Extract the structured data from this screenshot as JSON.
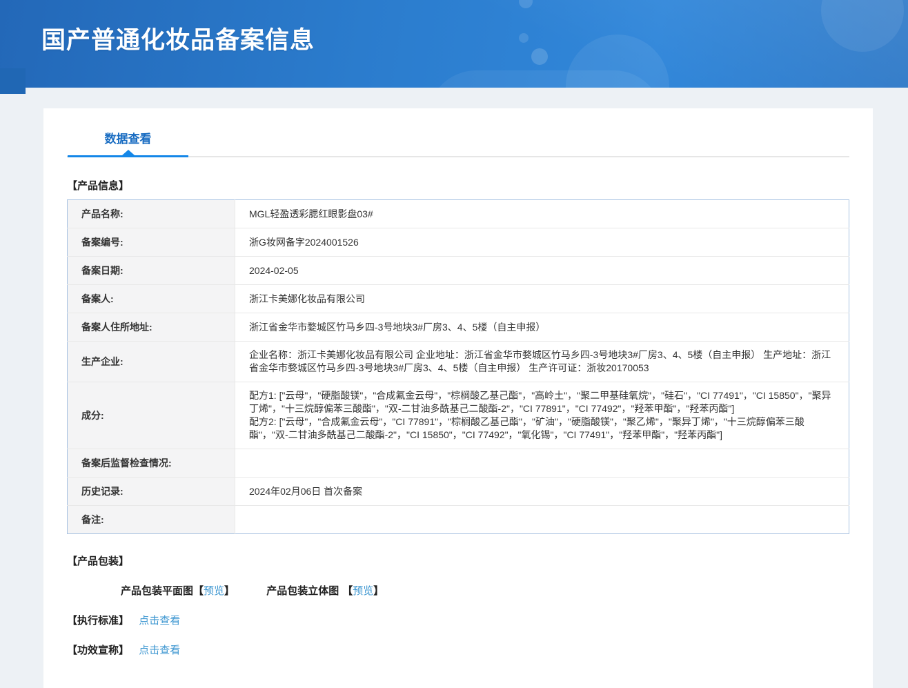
{
  "header": {
    "title": "国产普通化妆品备案信息"
  },
  "tabs": {
    "data_view": "数据查看"
  },
  "sections": {
    "product_info": "【产品信息】",
    "product_packaging": "【产品包装】",
    "execution_standard": "【执行标准】",
    "efficacy_claim": "【功效宣称】"
  },
  "table": {
    "rows": [
      {
        "label": "产品名称:",
        "value": "MGL轻盈透彩腮红眼影盘03#"
      },
      {
        "label": "备案编号:",
        "value": "浙G妆网备字2024001526"
      },
      {
        "label": "备案日期:",
        "value": "2024-02-05"
      },
      {
        "label": "备案人:",
        "value": "浙江卡美娜化妆品有限公司"
      },
      {
        "label": "备案人住所地址:",
        "value": "浙江省金华市婺城区竹马乡四-3号地块3#厂房3、4、5楼（自主申报）"
      },
      {
        "label": "生产企业:",
        "value": "企业名称：浙江卡美娜化妆品有限公司 企业地址：浙江省金华市婺城区竹马乡四-3号地块3#厂房3、4、5楼（自主申报） 生产地址：浙江省金华市婺城区竹马乡四-3号地块3#厂房3、4、5楼（自主申报） 生产许可证：浙妆20170053"
      },
      {
        "label": "成分:",
        "value_lines": [
          "配方1: [\"云母\"，\"硬脂酸镁\"，\"合成氟金云母\"，\"棕榈酸乙基己酯\"，\"高岭土\"，\"聚二甲基硅氧烷\"，\"硅石\"，\"CI 77491\"，\"CI 15850\"，\"聚异丁烯\"，\"十三烷醇偏苯三酸酯\"，\"双-二甘油多酰基己二酸酯-2\"，\"CI 77891\"，\"CI 77492\"，\"羟苯甲酯\"，\"羟苯丙酯\"]",
          "配方2: [\"云母\"，\"合成氟金云母\"，\"CI 77891\"，\"棕榈酸乙基己酯\"，\"矿油\"，\"硬脂酸镁\"，\"聚乙烯\"，\"聚异丁烯\"，\"十三烷醇偏苯三酸酯\"，\"双-二甘油多酰基己二酸酯-2\"，\"CI 15850\"，\"CI 77492\"，\"氧化锡\"，\"CI 77491\"，\"羟苯甲酯\"，\"羟苯丙酯\"]"
        ]
      },
      {
        "label": "备案后监督检查情况:",
        "value": ""
      },
      {
        "label": "历史记录:",
        "value": "2024年02月06日 首次备案"
      },
      {
        "label": "备注:",
        "value": ""
      }
    ]
  },
  "packaging": {
    "flat": {
      "label": "产品包装平面图",
      "bracket_open": "【",
      "link": "预览",
      "bracket_close": "】"
    },
    "stereo": {
      "label": "产品包装立体图",
      "bracket_open": "【",
      "link": "预览",
      "bracket_close": "】"
    }
  },
  "links": {
    "execution_standard": "点击查看",
    "efficacy_claim": "点击查看"
  },
  "colors": {
    "banner_blue": "#2b7ccd",
    "tab_blue": "#1a6dc2",
    "tab_bar_blue": "#1487e8",
    "link_blue": "#3e97d1",
    "table_border_blue": "#a9c3e2"
  }
}
